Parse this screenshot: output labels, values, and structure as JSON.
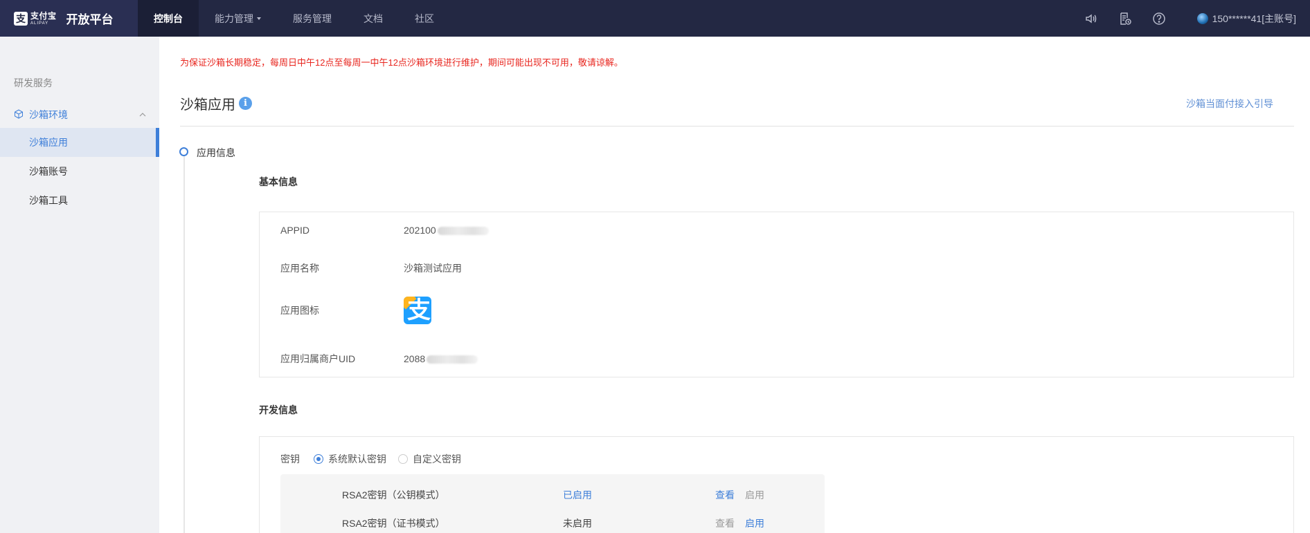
{
  "topbar": {
    "logo_cn": "支付宝",
    "logo_en": "ALIPAY",
    "brand_title": "开放平台",
    "nav": [
      {
        "label": "控制台",
        "active": true
      },
      {
        "label": "能力管理",
        "dropdown": true
      },
      {
        "label": "服务管理"
      },
      {
        "label": "文档"
      },
      {
        "label": "社区"
      }
    ],
    "icons": [
      "speaker-icon",
      "document-clock-icon",
      "help-icon"
    ],
    "account": "150******41[主账号]"
  },
  "sidebar": {
    "section": "研发服务",
    "group": "沙箱环境",
    "items": [
      {
        "label": "沙箱应用",
        "active": true
      },
      {
        "label": "沙箱账号"
      },
      {
        "label": "沙箱工具"
      }
    ]
  },
  "main": {
    "notice": "为保证沙箱长期稳定，每周日中午12点至每周一中午12点沙箱环境进行维护，期间可能出现不可用，敬请谅解。",
    "title": "沙箱应用",
    "info_badge": "i",
    "guide_link": "沙箱当面付接入引导",
    "step_label": "应用信息",
    "basic_title": "基本信息",
    "basic": {
      "appid_label": "APPID",
      "appid_value": "202100",
      "name_label": "应用名称",
      "name_value": "沙箱测试应用",
      "icon_label": "应用图标",
      "icon_glyph": "支",
      "uid_label": "应用归属商户UID",
      "uid_value": "2088"
    },
    "dev_title": "开发信息",
    "dev": {
      "key_label": "密钥",
      "options": [
        {
          "label": "系统默认密钥",
          "selected": true
        },
        {
          "label": "自定义密钥",
          "selected": false
        }
      ],
      "keys": [
        {
          "name": "RSA2密钥（公钥模式）",
          "status": "已启用",
          "view": "查看",
          "enable": "启用"
        },
        {
          "name": "RSA2密钥（证书模式）",
          "status": "未启用",
          "view": "查看",
          "enable": "启用"
        }
      ]
    }
  },
  "colors": {
    "topbar_bg": "#232843",
    "accent": "#3e7fd9",
    "notice_red": "#e8251e",
    "sidebar_bg": "#f0f1f4"
  }
}
